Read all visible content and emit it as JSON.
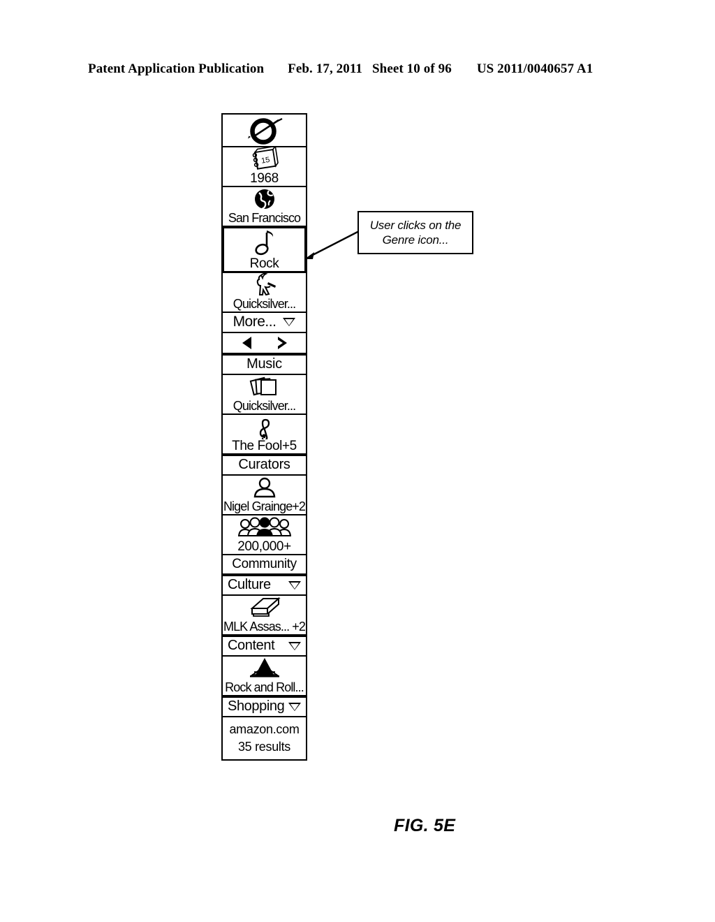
{
  "header": {
    "publication": "Patent Application Publication",
    "date": "Feb. 17, 2011",
    "sheet": "Sheet 10 of 96",
    "patent_number": "US 2011/0040657 A1"
  },
  "figure": {
    "label": "FIG. 5E"
  },
  "callout": {
    "text": "User clicks on the Genre icon..."
  },
  "widget": {
    "facets_panel": {
      "rows": [
        {
          "icon": "vinyl-record-icon",
          "label": ""
        },
        {
          "icon": "calendar-icon",
          "label": "1968",
          "icon_text": "15"
        },
        {
          "icon": "globe-icon",
          "label": "San Francisco"
        },
        {
          "icon": "music-note-icon",
          "label": "Rock",
          "selected": true
        },
        {
          "icon": "guitarist-icon",
          "label": "Quicksilver..."
        }
      ],
      "more_label": "More...",
      "nav": {
        "prev": "previous-arrow",
        "next": "next-arrow"
      }
    },
    "music_panel": {
      "title": "Music",
      "rows": [
        {
          "icon": "album-stack-icon",
          "label": "Quicksilver..."
        },
        {
          "icon": "treble-clef-icon",
          "label": "The Fool+5"
        }
      ]
    },
    "curators_panel": {
      "title": "Curators",
      "rows": [
        {
          "icon": "person-icon",
          "label": "Nigel Grainge+2"
        },
        {
          "icon": "group-icon",
          "label": "200,000+"
        }
      ],
      "footer_label": "Community"
    },
    "culture_panel": {
      "title": "Culture",
      "has_caret": true,
      "rows": [
        {
          "icon": "book-icon",
          "label": "MLK Assas... +2"
        }
      ]
    },
    "content_panel": {
      "title": "Content",
      "has_caret": true,
      "rows": [
        {
          "icon": "monument-icon",
          "label": "Rock and Roll..."
        }
      ]
    },
    "shopping_panel": {
      "title": "Shopping",
      "has_caret": true,
      "line1": "amazon.com",
      "line2": "35 results"
    }
  }
}
